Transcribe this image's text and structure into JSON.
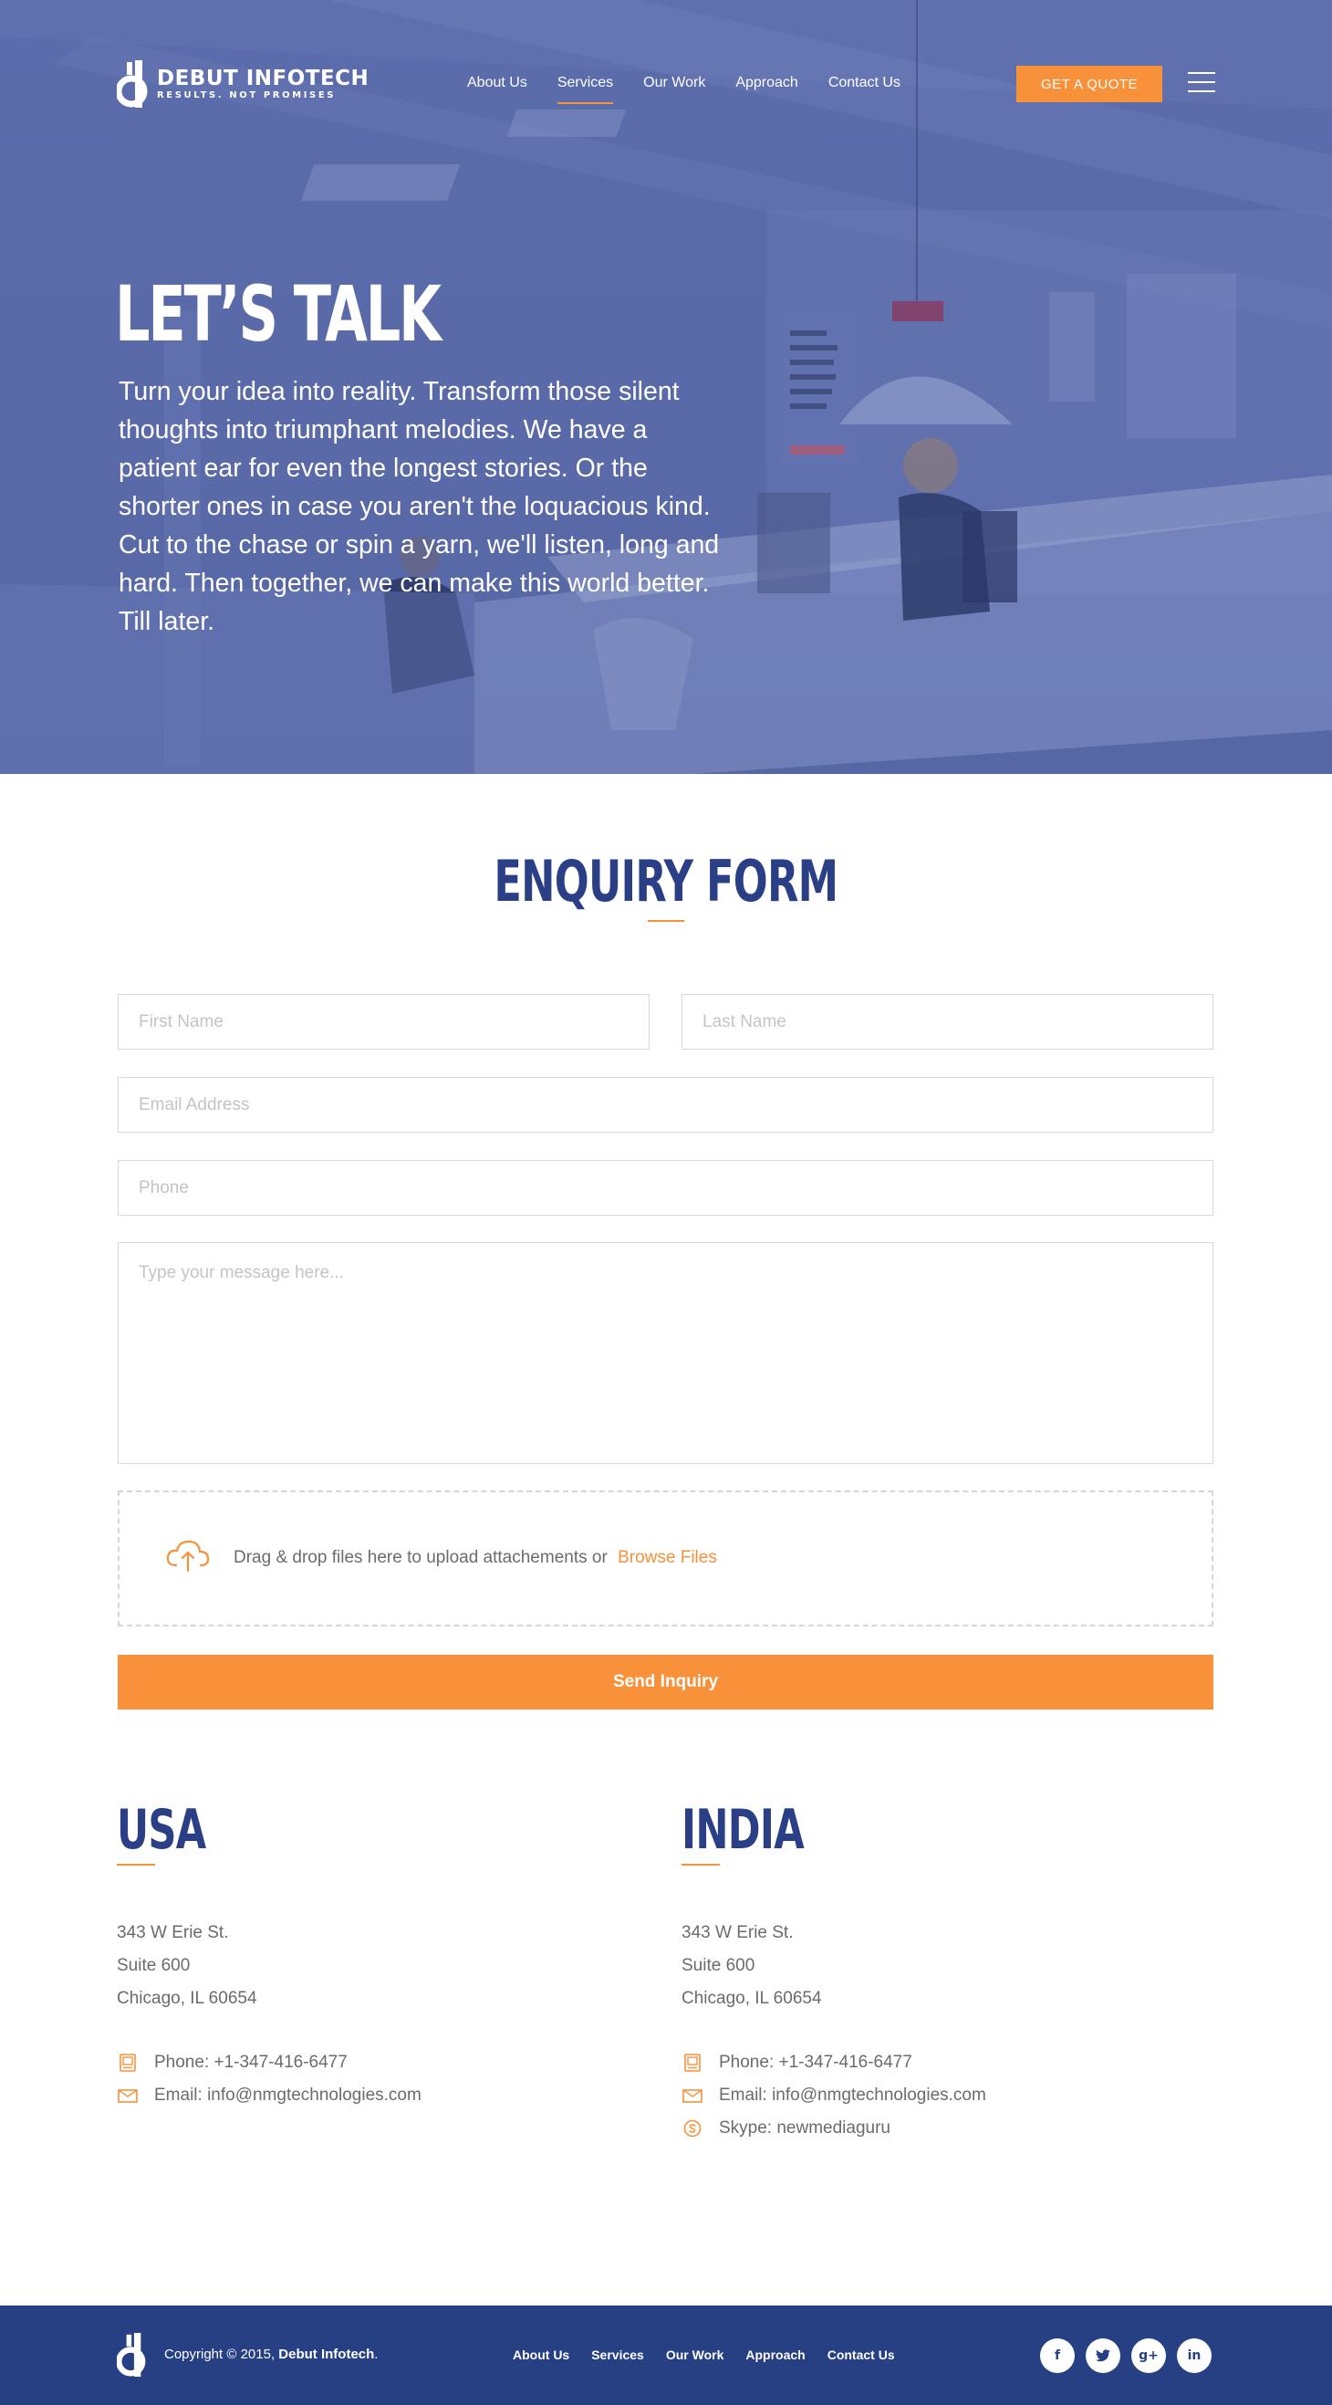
{
  "brand": {
    "name": "DEBUT INFOTECH",
    "tagline": "RESULTS. NOT PROMISES"
  },
  "nav": {
    "items": [
      {
        "label": "About Us",
        "active": false
      },
      {
        "label": "Services",
        "active": true
      },
      {
        "label": "Our Work",
        "active": false
      },
      {
        "label": "Approach",
        "active": false
      },
      {
        "label": "Contact Us",
        "active": false
      }
    ],
    "quote_label": "GET A QUOTE"
  },
  "hero": {
    "title": "LET’S TALK",
    "text": "Turn your idea into reality. Transform those silent thoughts into triumphant melodies. We have a patient ear for even the longest stories. Or the shorter ones in case you aren't the loquacious kind. Cut to the chase or spin a yarn, we'll listen, long and hard. Then together, we can make this world better. Till later."
  },
  "form": {
    "title": "ENQUIRY FORM",
    "first_name_placeholder": "First Name",
    "last_name_placeholder": "Last Name",
    "email_placeholder": "Email Address",
    "phone_placeholder": "Phone",
    "message_placeholder": "Type your message here...",
    "upload_text": "Drag & drop files here to upload attachements or",
    "browse_label": "Browse Files",
    "submit_label": "Send Inquiry"
  },
  "offices": [
    {
      "title": "USA",
      "address": [
        "343 W Erie St.",
        "Suite 600",
        "Chicago, IL 60654"
      ],
      "phone": "Phone: +1-347-416-6477",
      "email": "Email: info@nmgtechnologies.com"
    },
    {
      "title": "INDIA",
      "address": [
        "343 W Erie St.",
        "Suite 600",
        "Chicago, IL 60654"
      ],
      "phone": "Phone: +1-347-416-6477",
      "email": "Email: info@nmgtechnologies.com",
      "skype": "Skype: newmediaguru"
    }
  ],
  "footer": {
    "copyright_prefix": "Copyright © 2015,",
    "copyright_brand": "Debut Infotech",
    "copyright_suffix": ".",
    "nav": [
      "About Us",
      "Services",
      "Our Work",
      "Approach",
      "Contact Us"
    ],
    "socials": [
      {
        "icon": "facebook-icon",
        "glyph": "f"
      },
      {
        "icon": "twitter-icon",
        "glyph": "t"
      },
      {
        "icon": "google-plus-icon",
        "glyph": "g+"
      },
      {
        "icon": "linkedin-icon",
        "glyph": "in"
      }
    ]
  },
  "colors": {
    "accent": "#f7913a",
    "brand_blue": "#2a3f85",
    "hero_overlay": "#5b6cac",
    "footer_bg": "#273f83"
  }
}
